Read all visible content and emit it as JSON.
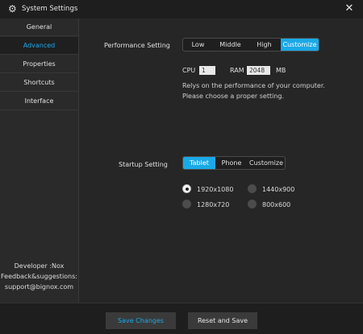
{
  "window": {
    "title": "System Settings",
    "title_icon": "gear-icon",
    "close_icon": "close-icon",
    "close_glyph": "✕"
  },
  "sidebar": {
    "items": [
      {
        "label": "General",
        "active": false
      },
      {
        "label": "Advanced",
        "active": true
      },
      {
        "label": "Properties",
        "active": false
      },
      {
        "label": "Shortcuts",
        "active": false
      },
      {
        "label": "Interface",
        "active": false
      }
    ],
    "developer": "Developer :Nox",
    "feedback": "Feedback&suggestions:",
    "email": "support@bignox.com"
  },
  "performance": {
    "label": "Performance Setting",
    "options": [
      "Low",
      "Middle",
      "High",
      "Customize"
    ],
    "selected": "Customize",
    "cpu_label": "CPU",
    "cpu_value": "1",
    "ram_label": "RAM",
    "ram_value": "2048",
    "ram_unit": "MB",
    "note_line1": "Relys on the performance of your computer.",
    "note_line2": "Please choose a proper setting."
  },
  "startup": {
    "label": "Startup Setting",
    "options": [
      "Tablet",
      "Phone",
      "Customize"
    ],
    "selected": "Tablet",
    "resolutions": [
      "1920x1080",
      "1440x900",
      "1280x720",
      "800x600"
    ],
    "selected_resolution": "1920x1080"
  },
  "footer": {
    "save_label": "Save Changes",
    "reset_label": "Reset and Save"
  },
  "colors": {
    "accent": "#1aa9e8",
    "bg": "#262626",
    "titlebar": "#1e1e1e"
  }
}
